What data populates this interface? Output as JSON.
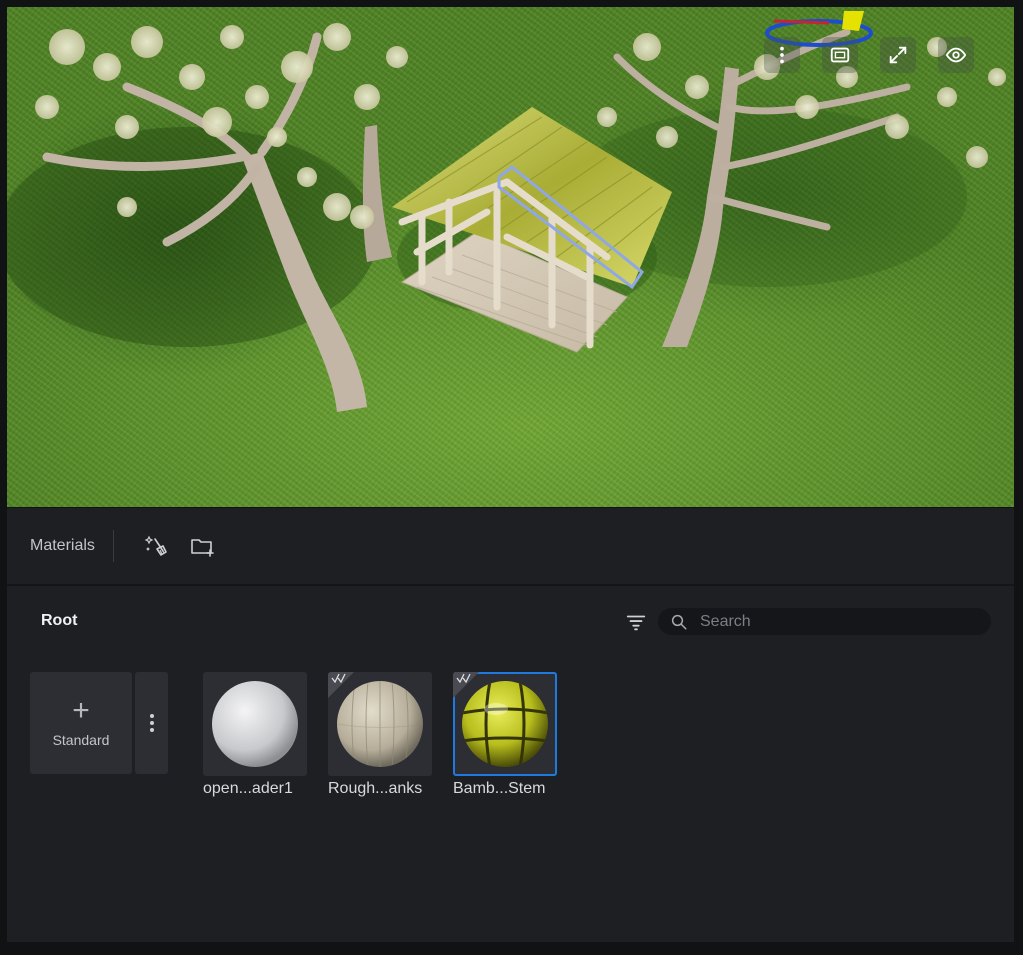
{
  "viewport": {
    "toolbar": [
      {
        "name": "more-options-icon",
        "label": "More options"
      },
      {
        "name": "camera-frame-icon",
        "label": "Camera frame"
      },
      {
        "name": "maximize-icon",
        "label": "Maximize"
      },
      {
        "name": "visibility-eye-icon",
        "label": "Visibility"
      }
    ]
  },
  "panel": {
    "title": "Materials",
    "header_icons": [
      "magic-clean-icon",
      "new-folder-icon"
    ],
    "breadcrumb_root": "Root",
    "search": {
      "placeholder": "Search",
      "value": ""
    },
    "new_material": {
      "plus": "+",
      "label": "Standard"
    },
    "materials": [
      {
        "name": "open...ader1",
        "preview": "white-sphere",
        "badge": false,
        "selected": false
      },
      {
        "name": "Rough...anks",
        "preview": "wood-sphere",
        "badge": true,
        "selected": false
      },
      {
        "name": "Bamb...Stem",
        "preview": "bamboo-sphere",
        "badge": true,
        "selected": true
      }
    ]
  },
  "colors": {
    "accent": "#1f7ae0",
    "panel_bg": "#1e1f23",
    "card_bg": "#2d2e33",
    "grass": "#5a9128"
  }
}
